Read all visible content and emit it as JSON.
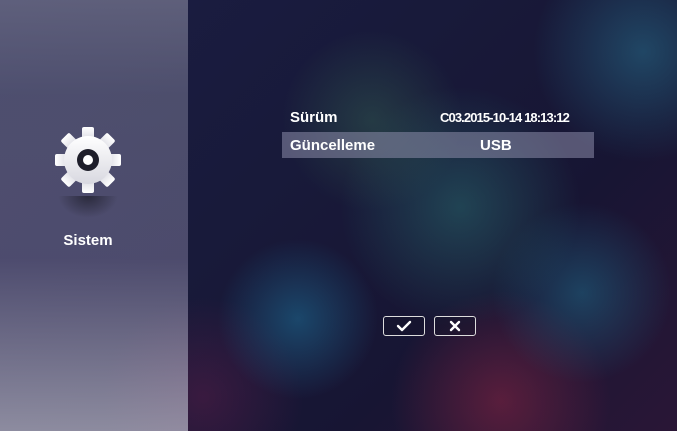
{
  "sidebar": {
    "section_label": "Sistem",
    "icon": "gear-icon"
  },
  "settings": {
    "rows": [
      {
        "label": "Sürüm",
        "value": "C03.2015-10-14 18:13:12"
      },
      {
        "label": "Güncelleme",
        "value": "USB",
        "selected": true
      }
    ]
  },
  "actions": {
    "confirm_icon": "checkmark-icon",
    "cancel_icon": "x-icon"
  }
}
